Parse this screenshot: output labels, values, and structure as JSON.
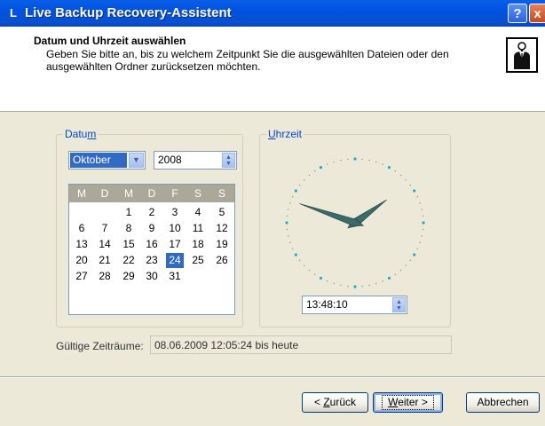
{
  "window": {
    "title": "Live Backup Recovery-Assistent",
    "title_icon": "L",
    "help_label": "?",
    "close_label": "x"
  },
  "header": {
    "title": "Datum und Uhrzeit auswählen",
    "description": "Geben Sie bitte an, bis zu welchem Zeitpunkt Sie die ausgewählten Dateien oder den ausgewählten Ordner zurücksetzen möchten.",
    "image_icon": "person-icon"
  },
  "datum": {
    "label_pre": "Datu",
    "label_accel": "m",
    "month": "Oktober",
    "year": "2008",
    "weekdays": [
      "M",
      "D",
      "M",
      "D",
      "F",
      "S",
      "S"
    ],
    "days": [
      [
        "",
        "",
        "1",
        "2",
        "3",
        "4",
        "5"
      ],
      [
        "6",
        "7",
        "8",
        "9",
        "10",
        "11",
        "12"
      ],
      [
        "13",
        "14",
        "15",
        "16",
        "17",
        "18",
        "19"
      ],
      [
        "20",
        "21",
        "22",
        "23",
        "24",
        "25",
        "26"
      ],
      [
        "27",
        "28",
        "29",
        "30",
        "31",
        "",
        ""
      ]
    ],
    "selected_day": "24"
  },
  "uhrzeit": {
    "label_accel": "U",
    "label_post": "hrzeit",
    "time": "13:48:10",
    "hour": 13,
    "minute": 48,
    "second": 10
  },
  "valid": {
    "label": "Gültige Zeiträume:",
    "value": "08.06.2009 12:05:24 bis heute"
  },
  "buttons": {
    "back_pre": "< ",
    "back_accel": "Z",
    "back_post": "urück",
    "next_accel": "W",
    "next_post": "eiter >",
    "cancel": "Abbrechen"
  },
  "colors": {
    "accent": "#316ac5",
    "titlebar": "#0053e1",
    "clock_hand": "#3a6b68",
    "clock_major_dot": "#1aaed0"
  }
}
